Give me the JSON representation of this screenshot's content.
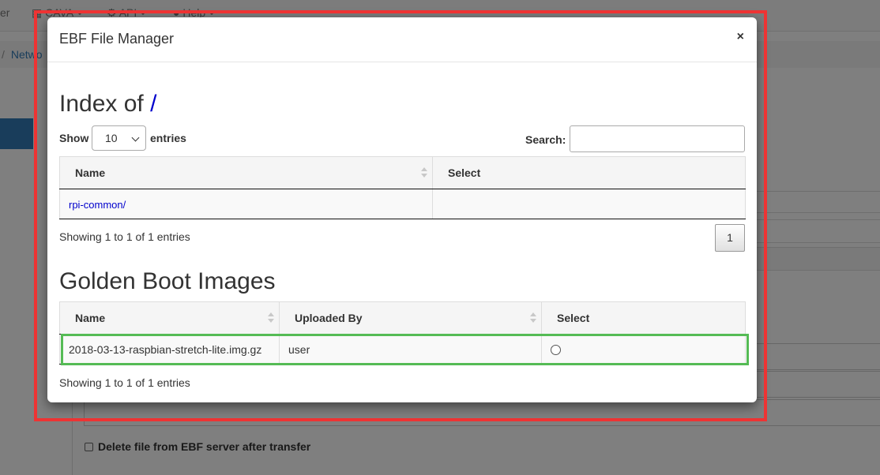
{
  "background": {
    "nav": [
      "er",
      "CAVA",
      "API",
      "Help"
    ],
    "breadcrumb": "Netwo",
    "checkbox_label": "Delete file from EBF server after transfer"
  },
  "modal": {
    "title": "EBF File Manager",
    "close_label": "×",
    "index": {
      "heading_prefix": "Index of ",
      "path": "/",
      "length": {
        "show_label": "Show",
        "selected": "10",
        "entries_label": "entries"
      },
      "search": {
        "label": "Search:",
        "value": ""
      },
      "columns": [
        "Name",
        "Select"
      ],
      "rows": [
        {
          "name": "rpi-common/"
        }
      ],
      "info": "Showing 1 to 1 of 1 entries",
      "pagination": [
        "1"
      ]
    },
    "golden": {
      "heading": "Golden Boot Images",
      "columns": [
        "Name",
        "Uploaded By",
        "Select"
      ],
      "rows": [
        {
          "name": "2018-03-13-raspbian-stretch-lite.img.gz",
          "uploaded_by": "user"
        }
      ],
      "info": "Showing 1 to 1 of 1 entries"
    }
  },
  "colors": {
    "highlight_frame": "#ee3333",
    "selected_row_frame": "#55bb55",
    "link": "#0000cc",
    "primary": "#337ab7"
  }
}
